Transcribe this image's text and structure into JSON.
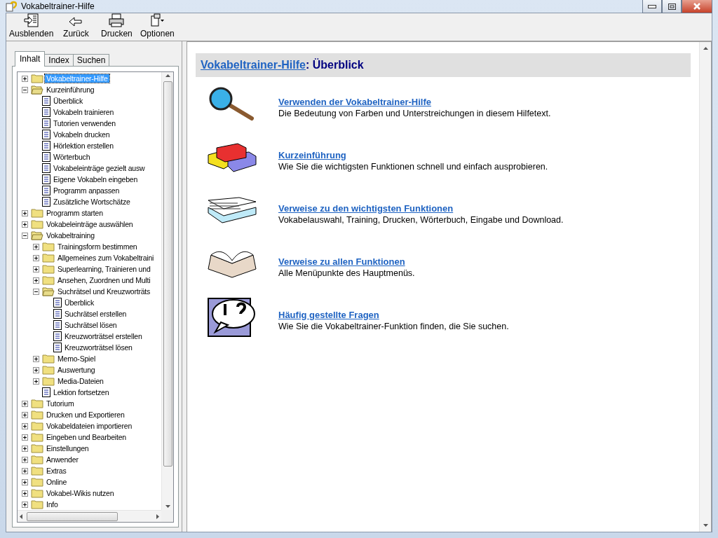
{
  "window": {
    "title": "Vokabeltrainer-Hilfe"
  },
  "toolbar": [
    {
      "kind": "hide",
      "label": "Ausblenden"
    },
    {
      "kind": "back",
      "label": "Zurück"
    },
    {
      "kind": "print",
      "label": "Drucken"
    },
    {
      "kind": "options",
      "label": "Optionen"
    }
  ],
  "tabs": [
    {
      "label": "Inhalt",
      "selected": true
    },
    {
      "label": "Index",
      "selected": false
    },
    {
      "label": "Suchen",
      "selected": false
    }
  ],
  "tree": [
    {
      "kind": "folder",
      "label": "Vokabeltrainer-Hilfe",
      "expanded": false,
      "selected": true
    },
    {
      "kind": "folder",
      "label": "Kurzeinführung",
      "expanded": true,
      "selected": false,
      "children": [
        {
          "kind": "page",
          "label": "Überblick",
          "selected": false
        },
        {
          "kind": "page",
          "label": "Vokabeln trainieren",
          "selected": false
        },
        {
          "kind": "page",
          "label": "Tutorien verwenden",
          "selected": false
        },
        {
          "kind": "page",
          "label": "Vokabeln drucken",
          "selected": false
        },
        {
          "kind": "page",
          "label": "Hörlektion erstellen",
          "selected": false
        },
        {
          "kind": "page",
          "label": "Wörterbuch",
          "selected": false
        },
        {
          "kind": "page",
          "label": "Vokabeleinträge gezielt ausw",
          "selected": false
        },
        {
          "kind": "page",
          "label": "Eigene Vokabeln eingeben",
          "selected": false
        },
        {
          "kind": "page",
          "label": "Programm anpassen",
          "selected": false
        },
        {
          "kind": "page",
          "label": "Zusätzliche Wortschätze",
          "selected": false
        }
      ]
    },
    {
      "kind": "folder",
      "label": "Programm starten",
      "expanded": false,
      "selected": false
    },
    {
      "kind": "folder",
      "label": "Vokabeleinträge auswählen",
      "expanded": false,
      "selected": false
    },
    {
      "kind": "folder",
      "label": "Vokabeltraining",
      "expanded": true,
      "selected": false,
      "children": [
        {
          "kind": "folder",
          "label": "Trainingsform bestimmen",
          "expanded": false,
          "selected": false
        },
        {
          "kind": "folder",
          "label": "Allgemeines zum Vokabeltraini",
          "expanded": false,
          "selected": false
        },
        {
          "kind": "folder",
          "label": "Superlearning, Trainieren und",
          "expanded": false,
          "selected": false
        },
        {
          "kind": "folder",
          "label": "Ansehen, Zuordnen und Multi",
          "expanded": false,
          "selected": false
        },
        {
          "kind": "folder",
          "label": "Suchrätsel und Kreuzworträts",
          "expanded": true,
          "selected": false,
          "children": [
            {
              "kind": "page",
              "label": "Überblick",
              "selected": false
            },
            {
              "kind": "page",
              "label": "Suchrätsel erstellen",
              "selected": false
            },
            {
              "kind": "page",
              "label": "Suchrätsel lösen",
              "selected": false
            },
            {
              "kind": "page",
              "label": "Kreuzworträtsel erstellen",
              "selected": false
            },
            {
              "kind": "page",
              "label": "Kreuzworträtsel lösen",
              "selected": false
            }
          ]
        },
        {
          "kind": "folder",
          "label": "Memo-Spiel",
          "expanded": false,
          "selected": false
        },
        {
          "kind": "folder",
          "label": "Auswertung",
          "expanded": false,
          "selected": false
        },
        {
          "kind": "folder",
          "label": "Media-Dateien",
          "expanded": false,
          "selected": false
        },
        {
          "kind": "page",
          "label": "Lektion fortsetzen",
          "selected": false
        }
      ]
    },
    {
      "kind": "folder",
      "label": "Tutorium",
      "expanded": false,
      "selected": false
    },
    {
      "kind": "folder",
      "label": "Drucken und Exportieren",
      "expanded": false,
      "selected": false
    },
    {
      "kind": "folder",
      "label": "Vokabeldateien importieren",
      "expanded": false,
      "selected": false
    },
    {
      "kind": "folder",
      "label": "Eingeben und Bearbeiten",
      "expanded": false,
      "selected": false
    },
    {
      "kind": "folder",
      "label": "Einstellungen",
      "expanded": false,
      "selected": false
    },
    {
      "kind": "folder",
      "label": "Anwender",
      "expanded": false,
      "selected": false
    },
    {
      "kind": "folder",
      "label": "Extras",
      "expanded": false,
      "selected": false
    },
    {
      "kind": "folder",
      "label": "Online",
      "expanded": false,
      "selected": false
    },
    {
      "kind": "folder",
      "label": "Vokabel-Wikis nutzen",
      "expanded": false,
      "selected": false
    },
    {
      "kind": "folder",
      "label": "Info",
      "expanded": false,
      "selected": false
    }
  ],
  "page": {
    "heading_link": "Vokabeltrainer-Hilfe",
    "heading_rest": ": Überblick",
    "entries": [
      {
        "kind": "magnifier",
        "link": "Verwenden der Vokabeltrainer-Hilfe",
        "text": "Die Bedeutung von Farben und Unterstreichungen in diesem Hilfetext."
      },
      {
        "kind": "bricks",
        "link": "Kurzeinführung",
        "text": "Wie Sie die wichtigsten Funktionen schnell und einfach ausprobieren."
      },
      {
        "kind": "papers",
        "link": "Verweise zu den wichtigsten Funktionen",
        "text": "Vokabelauswahl, Training, Drucken, Wörterbuch, Eingabe und Download."
      },
      {
        "kind": "book",
        "link": "Verweise zu allen Funktionen",
        "text": "Alle Menüpunkte des Hauptmenüs."
      },
      {
        "kind": "question",
        "link": "Häufig gestellte Fragen",
        "text": "Wie Sie die Vokabeltrainer-Funktion finden, die Sie suchen."
      }
    ]
  }
}
